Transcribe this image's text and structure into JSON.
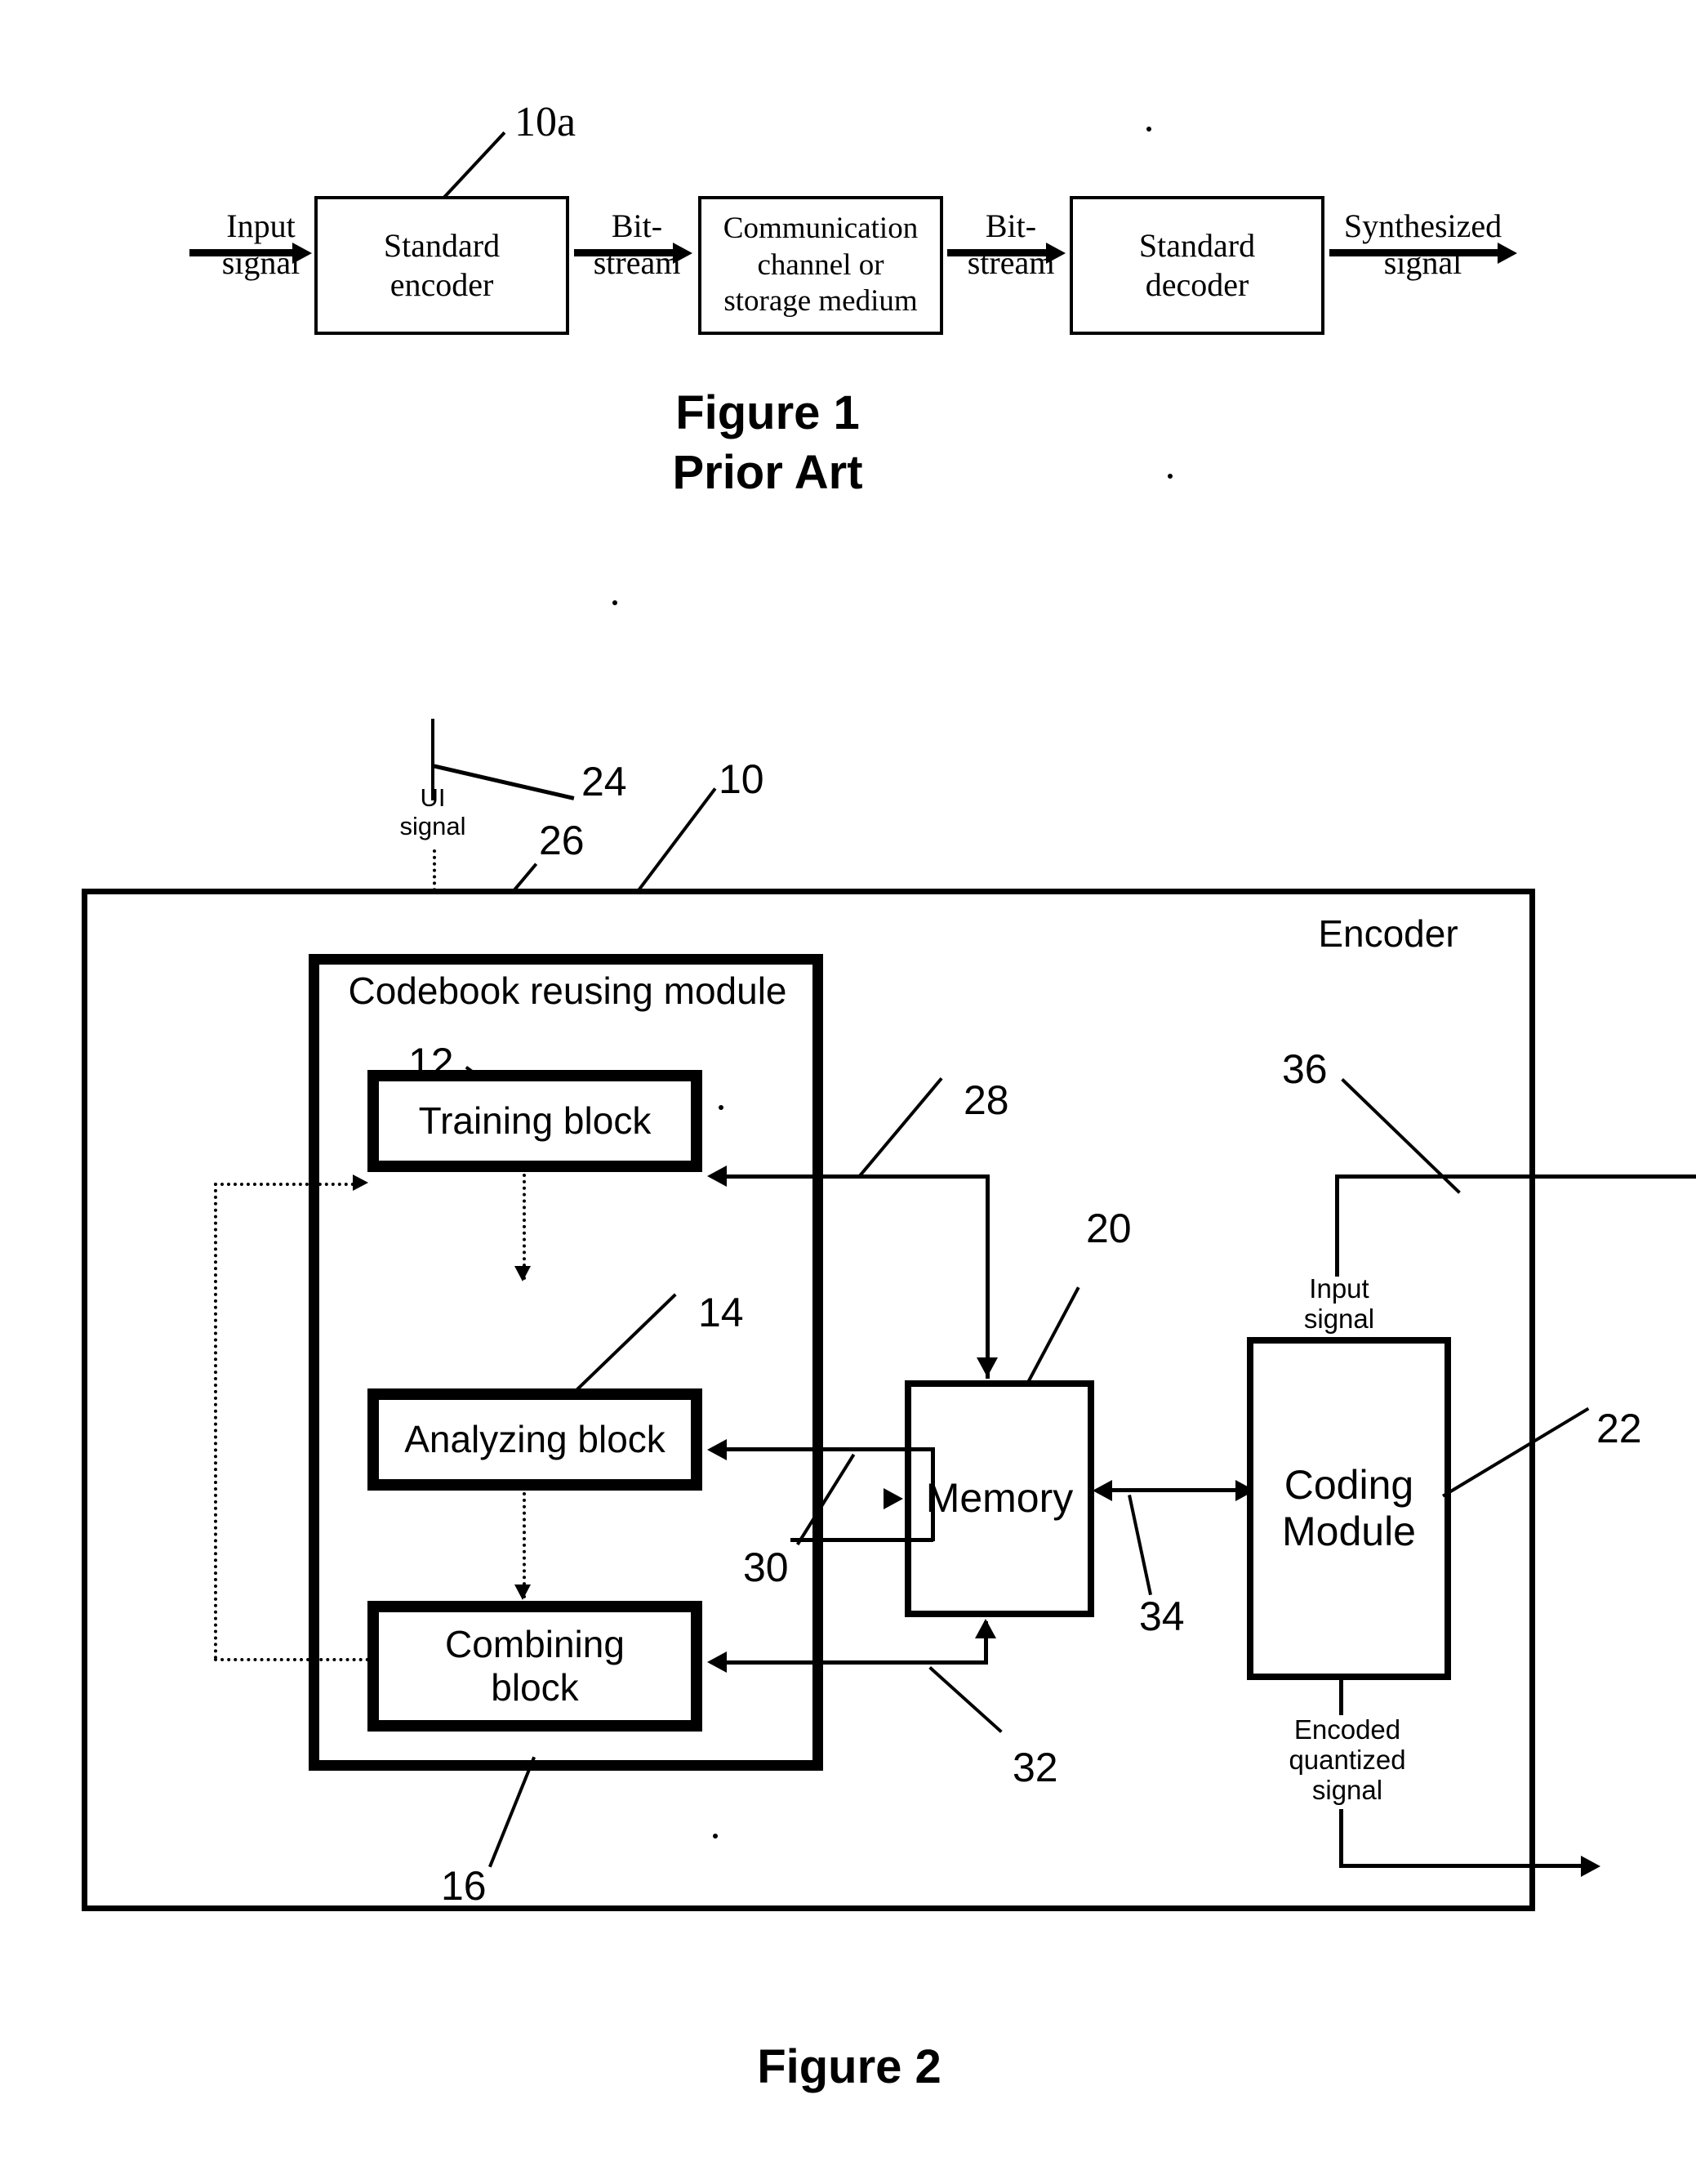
{
  "figure1": {
    "caption": "Figure 1\nPrior Art",
    "ref_10a": "10a",
    "label_input_signal": "Input\nsignal",
    "box_encoder": "Standard\nencoder",
    "label_bitstream_1": "Bit-\nstream",
    "box_channel": "Communication\nchannel or\nstorage medium",
    "label_bitstream_2": "Bit-\nstream",
    "box_decoder": "Standard\ndecoder",
    "label_synth_signal": "Synthesized\nsignal"
  },
  "figure2": {
    "caption": "Figure 2",
    "label_ui_signal": "UI\nsignal",
    "label_encoder": "Encoder",
    "label_input_signal": "Input\nsignal",
    "label_encoded_output": "Encoded\nquantized\nsignal",
    "box_codebook_module": "Codebook reusing module",
    "box_training": "Training block",
    "box_analyzing": "Analyzing block",
    "box_combining": "Combining\nblock",
    "box_memory": "Memory",
    "box_coding_module": "Coding\nModule",
    "ref_10": "10",
    "ref_12": "12",
    "ref_14": "14",
    "ref_16": "16",
    "ref_20": "20",
    "ref_22": "22",
    "ref_24": "24",
    "ref_26": "26",
    "ref_28": "28",
    "ref_30": "30",
    "ref_32": "32",
    "ref_34": "34",
    "ref_36": "36"
  },
  "colors": {
    "ink": "#000000",
    "paper": "#ffffff"
  }
}
